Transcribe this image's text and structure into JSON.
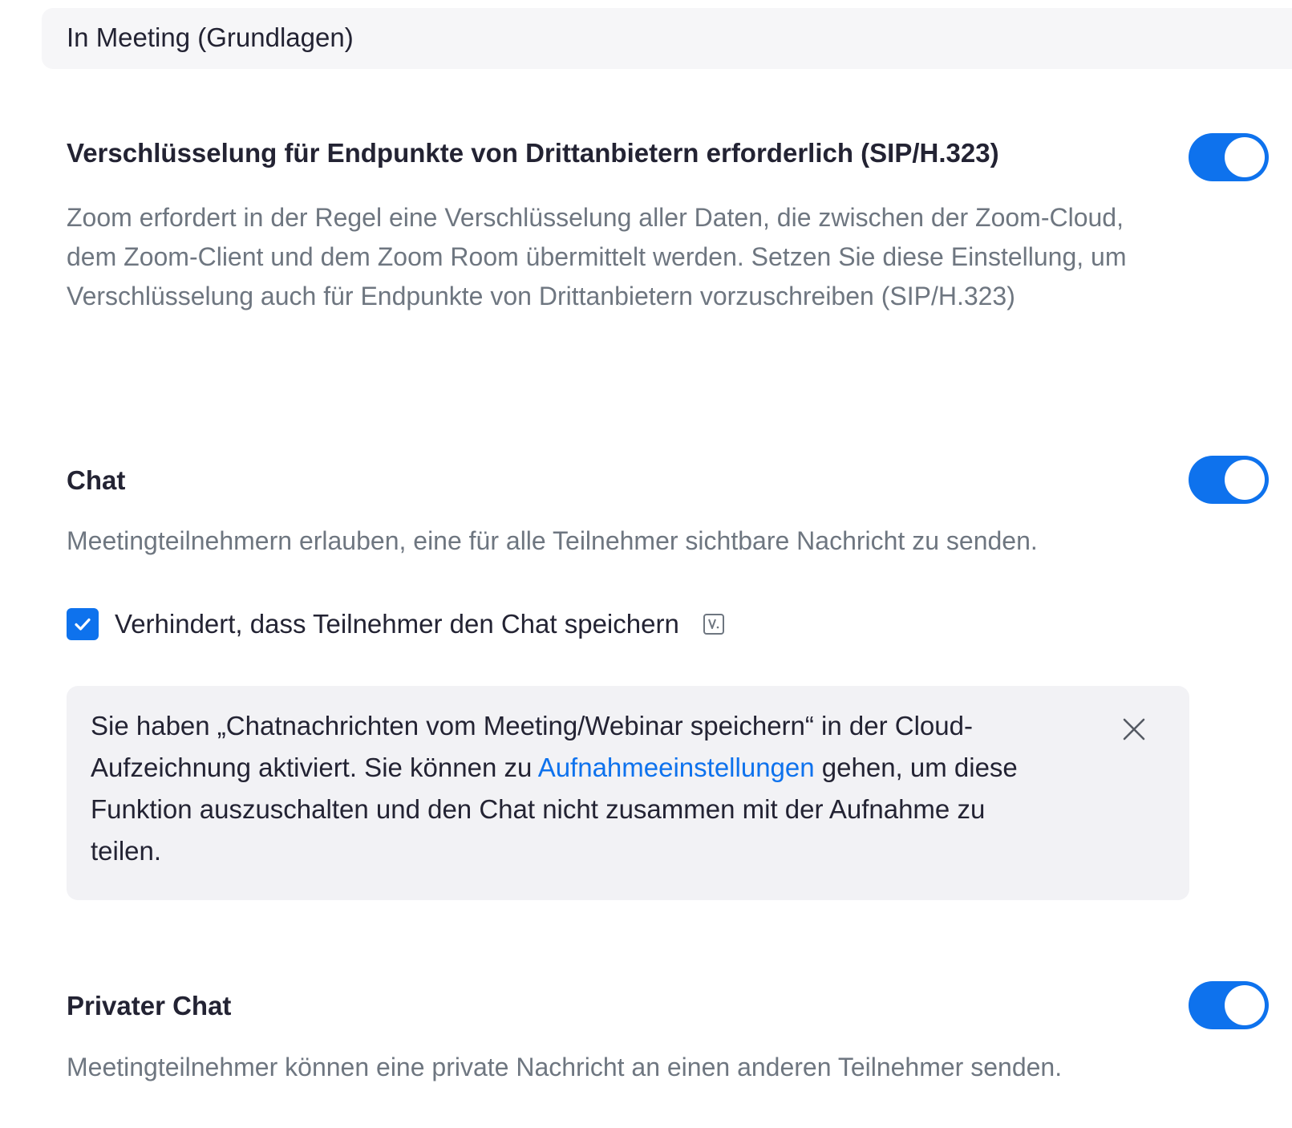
{
  "section": {
    "title": "In Meeting (Grundlagen)"
  },
  "settings": [
    {
      "title": "Verschlüsselung für Endpunkte von Drittanbietern erforderlich (SIP/H.323)",
      "description": "Zoom erfordert in der Regel eine Verschlüsselung aller Daten, die zwischen der Zoom-Cloud, dem Zoom-Client und dem Zoom Room übermittelt werden. Setzen Sie diese Einstellung, um Verschlüsselung auch für Endpunkte von Drittanbietern vorzuschreiben (SIP/H.323)",
      "enabled": true
    },
    {
      "title": "Chat",
      "description": "Meetingteilnehmern erlauben, eine für alle Teilnehmer sichtbare Nachricht zu senden.",
      "enabled": true,
      "option": {
        "label": "Verhindert, dass Teilnehmer den Chat speichern",
        "checked": true
      },
      "notice": {
        "text_before": "Sie haben „Chatnachrichten vom Meeting/Webinar speichern“ in der Cloud-Aufzeichnung aktiviert. Sie können zu ",
        "link": "Aufnahmeeinstellungen",
        "text_after": " gehen, um diese Funktion auszuschalten und den Chat nicht zusammen mit der Aufnahme zu teilen."
      }
    },
    {
      "title": "Privater Chat",
      "description": "Meetingteilnehmer können eine private Nachricht an einen anderen Teilnehmer senden.",
      "enabled": true
    }
  ],
  "colors": {
    "accent": "#0e72ed",
    "text": "#232333",
    "muted": "#6e7680",
    "panel": "#f6f6f8"
  },
  "icons": {
    "checkbox": "check-icon",
    "option_badge": "lock-icon",
    "notice_close": "close-icon"
  }
}
